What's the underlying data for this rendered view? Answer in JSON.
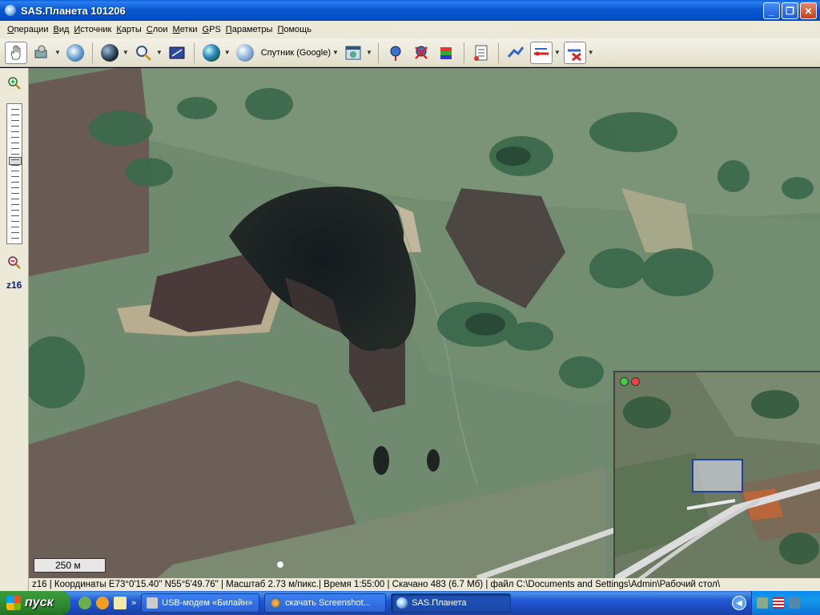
{
  "window": {
    "title": "SAS.Планета 101206",
    "buttons": {
      "minimize": "_",
      "maximize": "❐",
      "close": "✕"
    }
  },
  "menu": {
    "items": [
      "Операции",
      "Вид",
      "Источник",
      "Карты",
      "Слои",
      "Метки",
      "GPS",
      "Параметры",
      "Помощь"
    ]
  },
  "toolbar": {
    "source_label": "Спутник (Google)",
    "icons": [
      "hand-pan-icon",
      "move-icon",
      "gps-icon",
      "globe-icon",
      "magnifier-icon",
      "fullscreen-icon",
      "earth-icon",
      "satellite-source-icon",
      "map-window-icon",
      "marker-icon",
      "marker-remove-icon",
      "marker-layers-icon",
      "marks-list-icon",
      "route-icon",
      "route-edit-icon",
      "route-delete-icon"
    ]
  },
  "zoom": {
    "level_label": "z16",
    "slider_fraction": 0.4
  },
  "map": {
    "scale_label": "250 м"
  },
  "status": {
    "text": "z16 | Координаты E73°0'15.40\" N55°5'49.76\"     | Масштаб 2.73 м/пикс.| Время 1:55:00 | Скачано 483 (6.7 Мб) | файл C:\\Documents and Settings\\Admin\\Рабочий стол\\"
  },
  "taskbar": {
    "start_label": "пуск",
    "more_label": "»",
    "tasks": [
      {
        "label": "USB-модем «Билайн»"
      },
      {
        "label": "скачать Screenshot..."
      },
      {
        "label": "SAS.Планета"
      }
    ]
  },
  "colors": {
    "titlebar": "#0a58d0",
    "chrome": "#ece9d8",
    "taskbar": "#2157d7",
    "start": "#2f8a2f",
    "lake": "#1a2024"
  }
}
